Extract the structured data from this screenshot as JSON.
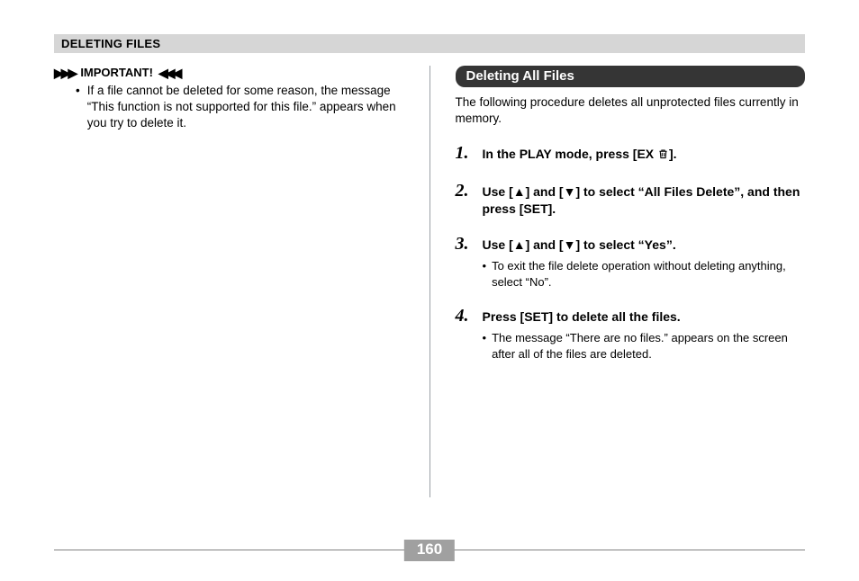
{
  "header": {
    "title": "DELETING FILES"
  },
  "left": {
    "important_label": "IMPORTANT!",
    "important_glyph_left": "▶▶▶",
    "important_glyph_right": "◀◀◀",
    "bullet": "If a file cannot be deleted for some reason, the message “This function is not supported for this file.” appears when you try to delete it."
  },
  "right": {
    "section_title": "Deleting All Files",
    "intro": "The following procedure deletes all unprotected files currently in memory.",
    "steps": [
      {
        "num": "1.",
        "text_a": "In the PLAY mode, press [EX ",
        "text_b": "]."
      },
      {
        "num": "2.",
        "text": "Use [▲] and [▼] to select “All Files Delete”, and then press [SET]."
      },
      {
        "num": "3.",
        "text": "Use [▲] and [▼] to select “Yes”.",
        "sub": "To exit the file delete operation without deleting anything, select “No”."
      },
      {
        "num": "4.",
        "text": "Press [SET] to delete all the files.",
        "sub": "The message “There are no files.” appears on the screen after all of the files are deleted."
      }
    ]
  },
  "footer": {
    "page_number": "160"
  }
}
